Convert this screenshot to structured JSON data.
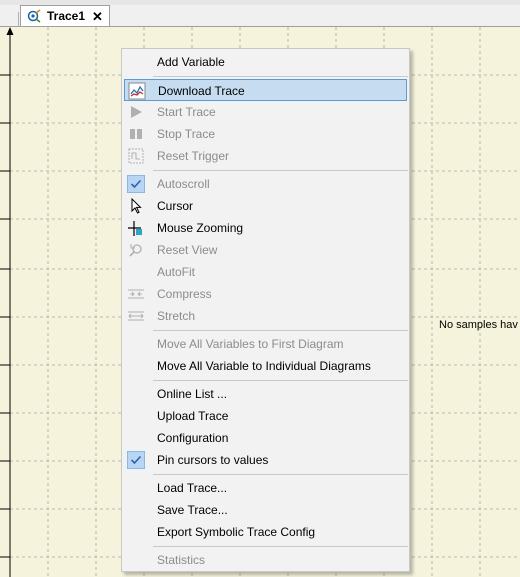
{
  "tab": {
    "title": "Trace1",
    "close": "✕"
  },
  "plot": {
    "no_samples_text": "No samples hav"
  },
  "menu": {
    "groups": [
      [
        {
          "label": "Add Variable",
          "enabled": true,
          "icon": ""
        }
      ],
      [
        {
          "label": "Download Trace",
          "enabled": true,
          "icon": "download-trace-icon",
          "highlighted": true
        },
        {
          "label": "Start Trace",
          "enabled": false,
          "icon": "play-icon"
        },
        {
          "label": "Stop Trace",
          "enabled": false,
          "icon": "stop-icon"
        },
        {
          "label": "Reset Trigger",
          "enabled": false,
          "icon": "reset-trigger-icon"
        }
      ],
      [
        {
          "label": "Autoscroll",
          "enabled": false,
          "icon": "check-icon",
          "checked": true
        },
        {
          "label": "Cursor",
          "enabled": true,
          "icon": "cursor-icon"
        },
        {
          "label": "Mouse Zooming",
          "enabled": true,
          "icon": "mouse-zoom-icon"
        },
        {
          "label": "Reset View",
          "enabled": false,
          "icon": "reset-view-icon"
        },
        {
          "label": "AutoFit",
          "enabled": false,
          "icon": ""
        },
        {
          "label": "Compress",
          "enabled": false,
          "icon": "compress-icon"
        },
        {
          "label": "Stretch",
          "enabled": false,
          "icon": "stretch-icon"
        }
      ],
      [
        {
          "label": "Move All Variables to First Diagram",
          "enabled": false,
          "icon": ""
        },
        {
          "label": "Move All Variable to Individual Diagrams",
          "enabled": true,
          "icon": ""
        }
      ],
      [
        {
          "label": "Online List ...",
          "enabled": true,
          "icon": ""
        },
        {
          "label": "Upload Trace",
          "enabled": true,
          "icon": ""
        },
        {
          "label": "Configuration",
          "enabled": true,
          "icon": ""
        },
        {
          "label": "Pin cursors to values",
          "enabled": true,
          "icon": "check-icon",
          "checked": true
        }
      ],
      [
        {
          "label": "Load Trace...",
          "enabled": true,
          "icon": ""
        },
        {
          "label": "Save Trace...",
          "enabled": true,
          "icon": ""
        },
        {
          "label": "Export Symbolic Trace Config",
          "enabled": true,
          "icon": ""
        }
      ],
      [
        {
          "label": "Statistics",
          "enabled": false,
          "icon": ""
        }
      ]
    ]
  },
  "colors": {
    "highlight_bg": "#c5dcf1",
    "highlight_border": "#5b9bd5",
    "disabled_text": "#8c8c8c",
    "plot_bg": "#f5f3dc"
  }
}
